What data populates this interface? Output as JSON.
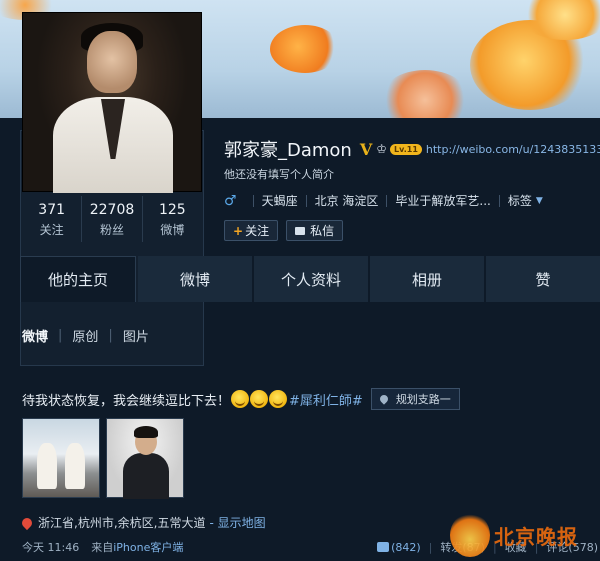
{
  "profile": {
    "name": "郭家豪_Damon",
    "verified_badge": "V",
    "level_badge": "Lv.11",
    "homepage_url": "http://weibo.com/u/1243835133",
    "bio": "他还没有填写个人简介",
    "gender_icon": "male-icon",
    "zodiac": "天蝎座",
    "location": "北京 海淀区",
    "school": "毕业于解放军艺...",
    "tags_label": "标签",
    "follow_label": "关注",
    "message_label": "私信",
    "stats": [
      {
        "value": "371",
        "label": "关注"
      },
      {
        "value": "22708",
        "label": "粉丝"
      },
      {
        "value": "125",
        "label": "微博"
      }
    ]
  },
  "tabs": [
    "他的主页",
    "微博",
    "个人资料",
    "相册",
    "赞"
  ],
  "subtabs": [
    "微博",
    "原创",
    "图片"
  ],
  "post": {
    "text": "待我状态恢复，我会继续逗比下去！",
    "emoji_count": 3,
    "hashtag": "#犀利仁師#",
    "location_tag": "规划支路一",
    "geo_location": "浙江省,杭州市,余杭区,五常大道",
    "map_link": "- 显示地图",
    "time": "今天 11:46",
    "source_prefix": "来自",
    "source_client": "iPhone客户端",
    "likes": "(842)",
    "repost_label": "转发(87)",
    "favorite_label": "收藏",
    "comment_label": "评论(578)"
  },
  "watermark": {
    "text": "北京晚报"
  },
  "colors": {
    "accent_blue": "#7fb2e5",
    "vip_gold": "#e8b21a",
    "background": "#0e1a28"
  }
}
